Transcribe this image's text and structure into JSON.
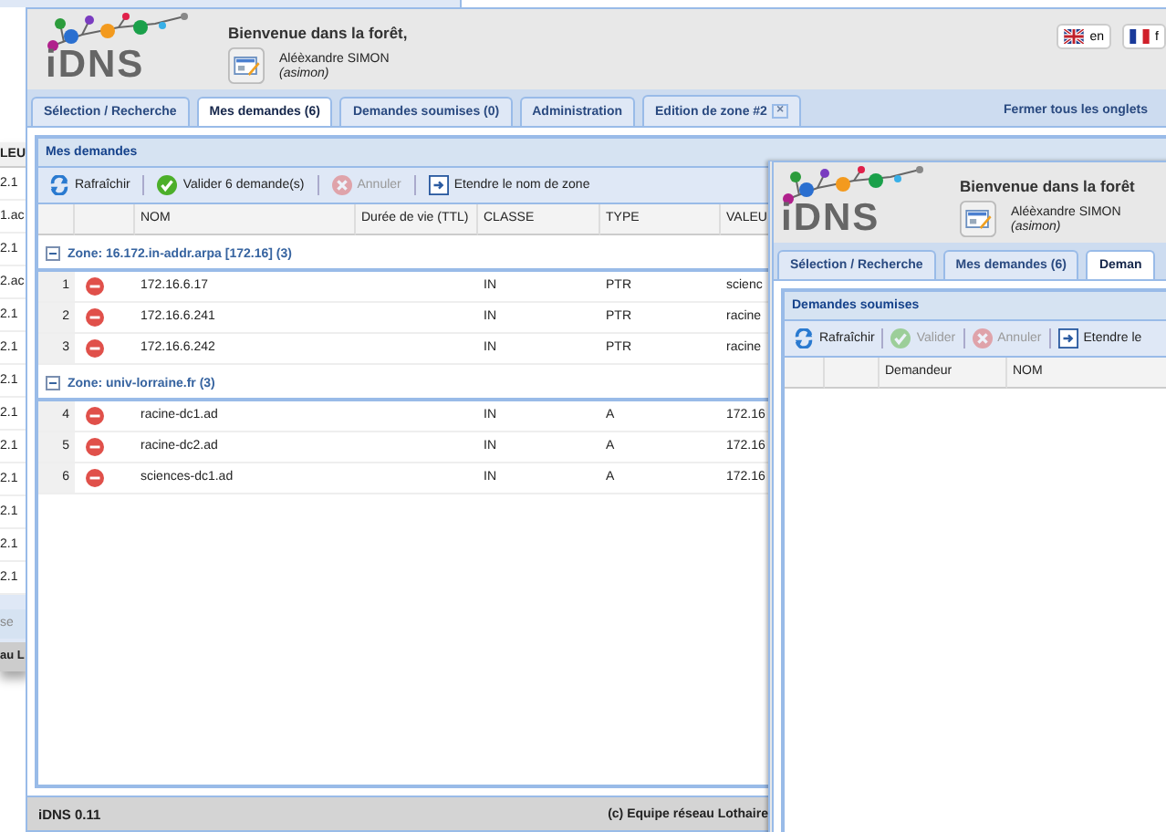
{
  "back_window": {
    "column_header": "LEU",
    "cells": [
      "2.1",
      "1.ac",
      "2.1",
      "2.ac",
      "2.1",
      "2.1",
      "2.1",
      "2.1",
      "2.1",
      "2.1",
      "2.1",
      "2.1",
      "2.1"
    ],
    "button": "se",
    "footer": "au L"
  },
  "main_window": {
    "header": {
      "logo_text": "iDNS",
      "title": "Bienvenue dans la forêt,",
      "user_name": "Aléèxandre SIMON",
      "user_login": "(asimon)",
      "languages": [
        {
          "label": "en",
          "kind": "uk"
        },
        {
          "label": "f",
          "kind": "fr"
        }
      ]
    },
    "tabs": [
      {
        "label": "Sélection / Recherche",
        "selected": false
      },
      {
        "label": "Mes demandes (6)",
        "selected": true
      },
      {
        "label": "Demandes soumises (0)",
        "selected": false
      },
      {
        "label": "Administration",
        "selected": false
      },
      {
        "label": "Edition de zone #2",
        "selected": false,
        "close_symbol": "×"
      }
    ],
    "close_all": "Fermer tous les onglets",
    "panel": {
      "title": "Mes demandes",
      "toolbar": [
        {
          "label": "Rafraîchir",
          "kind": "refresh",
          "disabled": false
        },
        {
          "label": "Valider 6 demande(s)",
          "kind": "validate",
          "disabled": false
        },
        {
          "label": "Annuler",
          "kind": "cancel",
          "disabled": true
        },
        {
          "label": "Etendre le nom de zone",
          "kind": "extend",
          "disabled": false
        }
      ],
      "columns": [
        "NOM",
        "Durée de vie (TTL)",
        "CLASSE",
        "TYPE",
        "VALEU"
      ],
      "groups": [
        {
          "label": "Zone: 16.172.in-addr.arpa [172.16] (3)",
          "expanded": true,
          "rows": [
            {
              "number": "1",
              "name": "172.16.6.17",
              "class": "IN",
              "type": "PTR",
              "value": "scienc"
            },
            {
              "number": "2",
              "name": "172.16.6.241",
              "class": "IN",
              "type": "PTR",
              "value": "racine"
            },
            {
              "number": "3",
              "name": "172.16.6.242",
              "class": "IN",
              "type": "PTR",
              "value": "racine"
            }
          ]
        },
        {
          "label": "Zone: univ-lorraine.fr (3)",
          "expanded": true,
          "rows": [
            {
              "number": "4",
              "name": "racine-dc1.ad",
              "class": "IN",
              "type": "A",
              "value": "172.16"
            },
            {
              "number": "5",
              "name": "racine-dc2.ad",
              "class": "IN",
              "type": "A",
              "value": "172.16"
            },
            {
              "number": "6",
              "name": "sciences-dc1.ad",
              "class": "IN",
              "type": "A",
              "value": "172.16"
            }
          ]
        }
      ]
    },
    "status_bar": {
      "version": "iDNS 0.11",
      "copyright": "(c) Equipe réseau Lothaire"
    }
  },
  "sub_window": {
    "header": {
      "logo_text": "iDNS",
      "title": "Bienvenue dans la forêt",
      "user_name": "Aléèxandre SIMON",
      "user_login": "(asimon)"
    },
    "tabs": [
      {
        "label": "Sélection / Recherche",
        "selected": false
      },
      {
        "label": "Mes demandes (6)",
        "selected": false
      },
      {
        "label": "Deman",
        "selected": true
      }
    ],
    "panel": {
      "title": "Demandes soumises",
      "toolbar": [
        {
          "label": "Rafraîchir",
          "kind": "refresh",
          "disabled": false
        },
        {
          "label": "Valider",
          "kind": "validate",
          "disabled": true
        },
        {
          "label": "Annuler",
          "kind": "cancel",
          "disabled": true
        },
        {
          "label": "Etendre le",
          "kind": "extend",
          "disabled": false
        }
      ],
      "columns": [
        "Demandeur",
        "NOM"
      ]
    }
  }
}
